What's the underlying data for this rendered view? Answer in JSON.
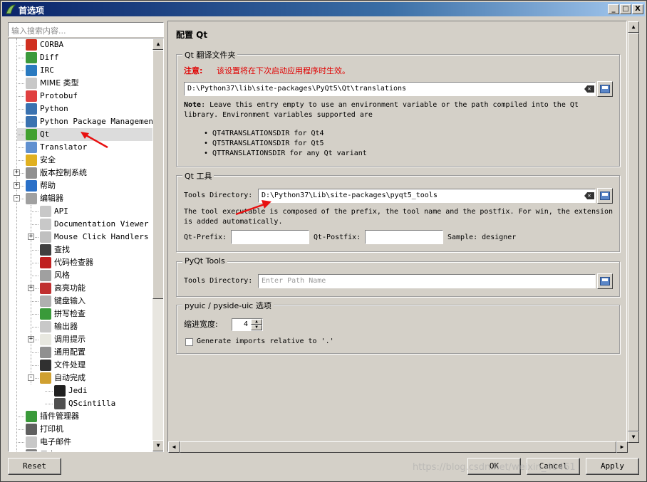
{
  "window": {
    "title": "首选项",
    "buttons": {
      "minimize": "_",
      "maximize": "□",
      "close": "X"
    }
  },
  "search": {
    "placeholder": "输入搜索内容..."
  },
  "tree": {
    "items": [
      {
        "label": "CORBA",
        "icon": "corba-icon",
        "color": "#d03020"
      },
      {
        "label": "Diff",
        "icon": "diff-icon",
        "color": "#3c9a3c"
      },
      {
        "label": "IRC",
        "icon": "irc-icon",
        "color": "#2a7ac0"
      },
      {
        "label": "MIME 类型",
        "icon": "mime-icon",
        "color": "#c8c8c8"
      },
      {
        "label": "Protobuf",
        "icon": "protobuf-icon",
        "color": "#e04040"
      },
      {
        "label": "Python",
        "icon": "python-icon",
        "color": "#3a72b0"
      },
      {
        "label": "Python Package Management",
        "icon": "python-package-icon",
        "color": "#3a72b0"
      },
      {
        "label": "Qt",
        "icon": "qt-icon",
        "color": "#41a030"
      },
      {
        "label": "Translator",
        "icon": "translator-icon",
        "color": "#6090d0"
      },
      {
        "label": "安全",
        "icon": "lock-icon",
        "color": "#e0b020"
      },
      {
        "label": "版本控制系统",
        "icon": "vcs-icon",
        "color": "#909090"
      },
      {
        "label": "帮助",
        "icon": "help-icon",
        "color": "#2a70c8"
      },
      {
        "label": "编辑器",
        "icon": "editor-icon",
        "color": "#a0a0a0"
      },
      {
        "label": "API",
        "icon": "api-icon",
        "color": "#c8c8c8"
      },
      {
        "label": "Documentation Viewer",
        "icon": "documentation-icon",
        "color": "#c8c8c8"
      },
      {
        "label": "Mouse Click Handlers",
        "icon": "mouse-icon",
        "color": "#c0c0c0"
      },
      {
        "label": "查找",
        "icon": "binoculars-icon",
        "color": "#404040"
      },
      {
        "label": "代码检查器",
        "icon": "bug-icon",
        "color": "#c02020"
      },
      {
        "label": "风格",
        "icon": "style-icon",
        "color": "#a0a0a0"
      },
      {
        "label": "高亮功能",
        "icon": "highlight-icon",
        "color": "#c03030"
      },
      {
        "label": "键盘输入",
        "icon": "keyboard-icon",
        "color": "#b0b0b0"
      },
      {
        "label": "拼写检查",
        "icon": "spellcheck-icon",
        "color": "#3a9a3a"
      },
      {
        "label": "输出器",
        "icon": "exporter-icon",
        "color": "#c8c8c8"
      },
      {
        "label": "调用提示",
        "icon": "calltips-icon",
        "color": "#e8e8e0"
      },
      {
        "label": "通用配置",
        "icon": "wrench-icon",
        "color": "#909090"
      },
      {
        "label": "文件处理",
        "icon": "save-icon",
        "color": "#303030"
      },
      {
        "label": "自动完成",
        "icon": "autocomplete-icon",
        "color": "#d0a030"
      },
      {
        "label": "Jedi",
        "icon": "jedi-icon",
        "color": "#202020"
      },
      {
        "label": "QScintilla",
        "icon": "qscintilla-icon",
        "color": "#505050"
      },
      {
        "label": "插件管理器",
        "icon": "plugin-icon",
        "color": "#3a9a3a"
      },
      {
        "label": "打印机",
        "icon": "printer-icon",
        "color": "#606060"
      },
      {
        "label": "电子邮件",
        "icon": "email-icon",
        "color": "#c8c8c8"
      },
      {
        "label": "用户",
        "icon": "user-icon",
        "color": "#808080"
      }
    ]
  },
  "page": {
    "title": "配置 Qt",
    "translations": {
      "group_title": "Qt 翻译文件夹",
      "note_label": "注意:",
      "note_text": "该设置将在下次启动应用程序时生效。",
      "path": "D:\\Python37\\lib\\site-packages\\PyQt5\\Qt\\translations",
      "help_bold": "Note",
      "help_line1": ": Leave this entry empty to use an environment variable or the path compiled into the Qt",
      "help_line2": "library. Environment variables supported are",
      "bullets": [
        "QT4TRANSLATIONSDIR for Qt4",
        "QT5TRANSLATIONSDIR for Qt5",
        "QTTRANSLATIONSDIR for any Qt variant"
      ]
    },
    "tools": {
      "group_title": "Qt 工具",
      "dir_label": "Tools Directory:",
      "dir_value": "D:\\Python37\\Lib\\site-packages\\pyqt5_tools",
      "desc_line1": "The tool executable is composed of the prefix, the tool name and the postfix. For win, the extension",
      "desc_line2": "is added automatically.",
      "prefix_label": "Qt-Prefix:",
      "prefix_value": "",
      "postfix_label": "Qt-Postfix:",
      "postfix_value": "",
      "sample": "Sample: designer"
    },
    "pyqt": {
      "group_title": "PyQt Tools",
      "dir_label": "Tools Directory:",
      "dir_placeholder": "Enter Path Name"
    },
    "pyuic": {
      "group_title": "pyuic / pyside-uic 选项",
      "indent_label": "缩进宽度:",
      "indent_value": "4",
      "gen_imports_label": "Generate imports relative to '.'"
    }
  },
  "buttons": {
    "reset": "Reset",
    "ok": "OK",
    "cancel": "Cancel",
    "apply": "Apply"
  },
  "watermark": "https://blog.csdn.net/weixin_40461"
}
